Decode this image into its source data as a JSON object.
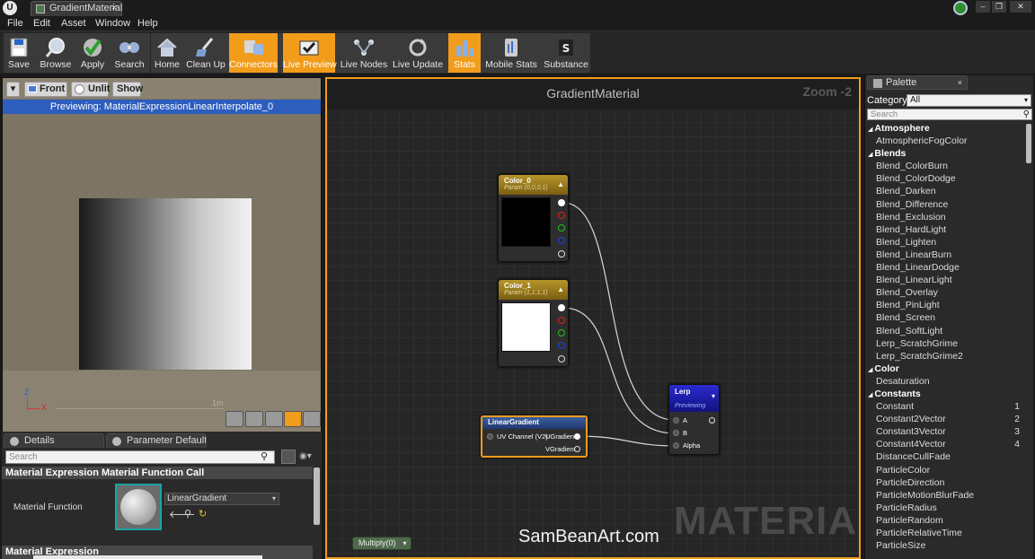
{
  "window": {
    "logo_glyph": "U",
    "tab_title": "GradientMaterial",
    "tab_close": "×",
    "controls": [
      "–",
      "❐",
      "✕"
    ]
  },
  "menu": [
    "File",
    "Edit",
    "Asset",
    "Window",
    "Help"
  ],
  "toolbar": {
    "buttons": [
      {
        "label": "Save",
        "icon": "save-icon",
        "active": false
      },
      {
        "label": "Browse",
        "icon": "browse-icon",
        "active": false
      },
      {
        "label": "Apply",
        "icon": "apply-icon",
        "active": false
      },
      {
        "label": "Search",
        "icon": "search-icon",
        "active": false
      },
      {
        "label": "Home",
        "icon": "home-icon",
        "active": false
      },
      {
        "label": "Clean Up",
        "icon": "clean-up-icon",
        "active": false
      },
      {
        "label": "Connectors",
        "icon": "connectors-icon",
        "active": true
      },
      {
        "label": "Live Preview",
        "icon": "live-preview-icon",
        "active": true
      },
      {
        "label": "Live Nodes",
        "icon": "live-nodes-icon",
        "active": false
      },
      {
        "label": "Live Update",
        "icon": "live-update-icon",
        "active": false
      },
      {
        "label": "Stats",
        "icon": "stats-icon",
        "active": true
      },
      {
        "label": "Mobile Stats",
        "icon": "mobile-stats-icon",
        "active": false
      },
      {
        "label": "Substance",
        "icon": "substance-icon",
        "active": false
      }
    ],
    "active_color": "#f29c1c"
  },
  "viewport": {
    "menu_arrow": "▾",
    "front_label": "Front",
    "unlit_label": "Unlit",
    "show_label": "Show",
    "banner": "Previewing: MaterialExpressionLinearInterpolate_0",
    "axis_z": "Z",
    "axis_x": "X",
    "scale": "1m",
    "banner_color": "#2d5dbd"
  },
  "details": {
    "tabs": [
      "Details",
      "Parameter Defaults"
    ],
    "search_placeholder": "Search",
    "search_icon": "⚲",
    "eye_glyph": "◉▾",
    "section1": "Material Expression Material Function Call",
    "function_label": "Material Function",
    "function_value": "LinearGradient",
    "combo_arrow": "▾",
    "actions": [
      "🡐",
      "⚲",
      "↻"
    ],
    "section2": "Material Expression"
  },
  "graph": {
    "title": "GradientMaterial",
    "zoom": "Zoom -2",
    "watermark": "MATERIAL",
    "credit": "SamBeanArt.com",
    "multiply_button": "Multiply(0)",
    "multiply_arrow": "▾",
    "nodes": {
      "color0": {
        "title": "Color_0",
        "subtitle": "Param (0,0,0,1)",
        "collapse": "▲",
        "swatch": "#000000"
      },
      "color1": {
        "title": "Color_1",
        "subtitle": "Param (1,1,1,1)",
        "collapse": "▲",
        "swatch": "#ffffff"
      },
      "lerp": {
        "title": "Lerp",
        "subtitle": "Previewing",
        "collapse": "▾",
        "inputs": [
          "A",
          "B",
          "Alpha"
        ]
      },
      "linear_gradient": {
        "title": "LinearGradient",
        "input": "UV Channel (V2)",
        "outputs": [
          "UGradient",
          "VGradient"
        ]
      }
    },
    "pin_colors": [
      "#ffffff",
      "#e02020",
      "#20c020",
      "#2040e0",
      "#d0d0d0"
    ]
  },
  "palette": {
    "tab": "Palette",
    "tab_close": "×",
    "category_label": "Category:",
    "category_value": "All",
    "category_arrow": "▾",
    "search_placeholder": "Search",
    "search_icon": "⚲",
    "collapse_glyph": "◢",
    "rows": [
      {
        "type": "cat",
        "label": "Atmosphere"
      },
      {
        "type": "item",
        "label": "AtmosphericFogColor"
      },
      {
        "type": "cat",
        "label": "Blends"
      },
      {
        "type": "item",
        "label": "Blend_ColorBurn"
      },
      {
        "type": "item",
        "label": "Blend_ColorDodge"
      },
      {
        "type": "item",
        "label": "Blend_Darken"
      },
      {
        "type": "item",
        "label": "Blend_Difference"
      },
      {
        "type": "item",
        "label": "Blend_Exclusion"
      },
      {
        "type": "item",
        "label": "Blend_HardLight"
      },
      {
        "type": "item",
        "label": "Blend_Lighten"
      },
      {
        "type": "item",
        "label": "Blend_LinearBurn"
      },
      {
        "type": "item",
        "label": "Blend_LinearDodge"
      },
      {
        "type": "item",
        "label": "Blend_LinearLight"
      },
      {
        "type": "item",
        "label": "Blend_Overlay"
      },
      {
        "type": "item",
        "label": "Blend_PinLight"
      },
      {
        "type": "item",
        "label": "Blend_Screen"
      },
      {
        "type": "item",
        "label": "Blend_SoftLight"
      },
      {
        "type": "item",
        "label": "Lerp_ScratchGrime"
      },
      {
        "type": "item",
        "label": "Lerp_ScratchGrime2"
      },
      {
        "type": "cat",
        "label": "Color"
      },
      {
        "type": "item",
        "label": "Desaturation"
      },
      {
        "type": "cat",
        "label": "Constants"
      },
      {
        "type": "item",
        "label": "Constant",
        "hotkey": "1"
      },
      {
        "type": "item",
        "label": "Constant2Vector",
        "hotkey": "2"
      },
      {
        "type": "item",
        "label": "Constant3Vector",
        "hotkey": "3"
      },
      {
        "type": "item",
        "label": "Constant4Vector",
        "hotkey": "4"
      },
      {
        "type": "item",
        "label": "DistanceCullFade"
      },
      {
        "type": "item",
        "label": "ParticleColor"
      },
      {
        "type": "item",
        "label": "ParticleDirection"
      },
      {
        "type": "item",
        "label": "ParticleMotionBlurFade"
      },
      {
        "type": "item",
        "label": "ParticleRadius"
      },
      {
        "type": "item",
        "label": "ParticleRandom"
      },
      {
        "type": "item",
        "label": "ParticleRelativeTime"
      },
      {
        "type": "item",
        "label": "ParticleSize"
      }
    ]
  }
}
